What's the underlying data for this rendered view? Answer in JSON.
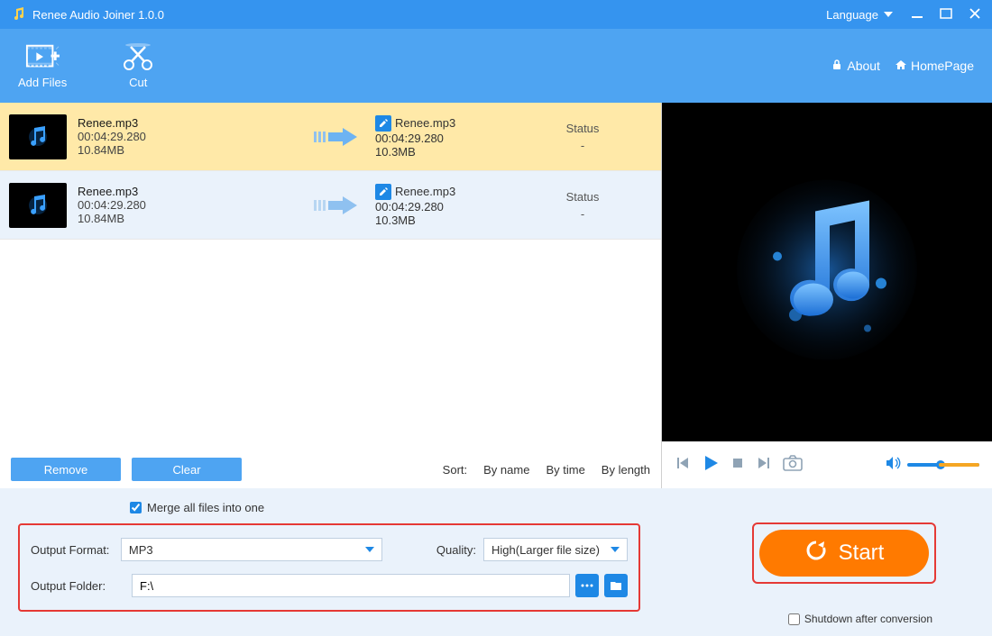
{
  "titlebar": {
    "title": "Renee Audio Joiner 1.0.0",
    "language_label": "Language"
  },
  "toolbar": {
    "add_files": "Add Files",
    "cut": "Cut",
    "about": "About",
    "homepage": "HomePage"
  },
  "files": [
    {
      "name": "Renee.mp3",
      "duration": "00:04:29.280",
      "size": "10.84MB",
      "out_name": "Renee.mp3",
      "out_duration": "00:04:29.280",
      "out_size": "10.3MB",
      "status_label": "Status",
      "status_value": "-"
    },
    {
      "name": "Renee.mp3",
      "duration": "00:04:29.280",
      "size": "10.84MB",
      "out_name": "Renee.mp3",
      "out_duration": "00:04:29.280",
      "out_size": "10.3MB",
      "status_label": "Status",
      "status_value": "-"
    }
  ],
  "list_footer": {
    "remove": "Remove",
    "clear": "Clear",
    "sort_label": "Sort:",
    "by_name": "By name",
    "by_time": "By time",
    "by_length": "By length"
  },
  "bottom": {
    "merge_label": "Merge all files into one",
    "output_format_label": "Output Format:",
    "output_format_value": "MP3",
    "quality_label": "Quality:",
    "quality_value": "High(Larger file size)",
    "output_folder_label": "Output Folder:",
    "output_folder_value": "F:\\",
    "start": "Start",
    "shutdown": "Shutdown after conversion"
  }
}
